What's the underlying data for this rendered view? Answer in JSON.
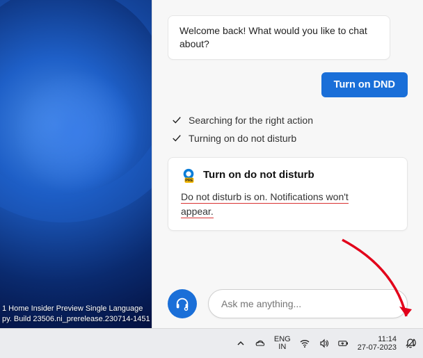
{
  "watermark": {
    "line1": "1 Home Insider Preview Single Language",
    "line2": "py. Build 23506.ni_prerelease.230714-1451"
  },
  "chat": {
    "assistant_welcome": "Welcome back! What would you like to chat about?",
    "user_message": "Turn on DND",
    "status": {
      "item1": "Searching for the right action",
      "item2": "Turning on do not disturb"
    },
    "action": {
      "title": "Turn on do not disturb",
      "desc_seg1": "Do not disturb is on. Notifications won't",
      "desc_seg2": "appear."
    },
    "input_placeholder": "Ask me anything..."
  },
  "taskbar": {
    "lang_top": "ENG",
    "lang_bottom": "IN",
    "time": "11:14",
    "date": "27-07-2023"
  }
}
